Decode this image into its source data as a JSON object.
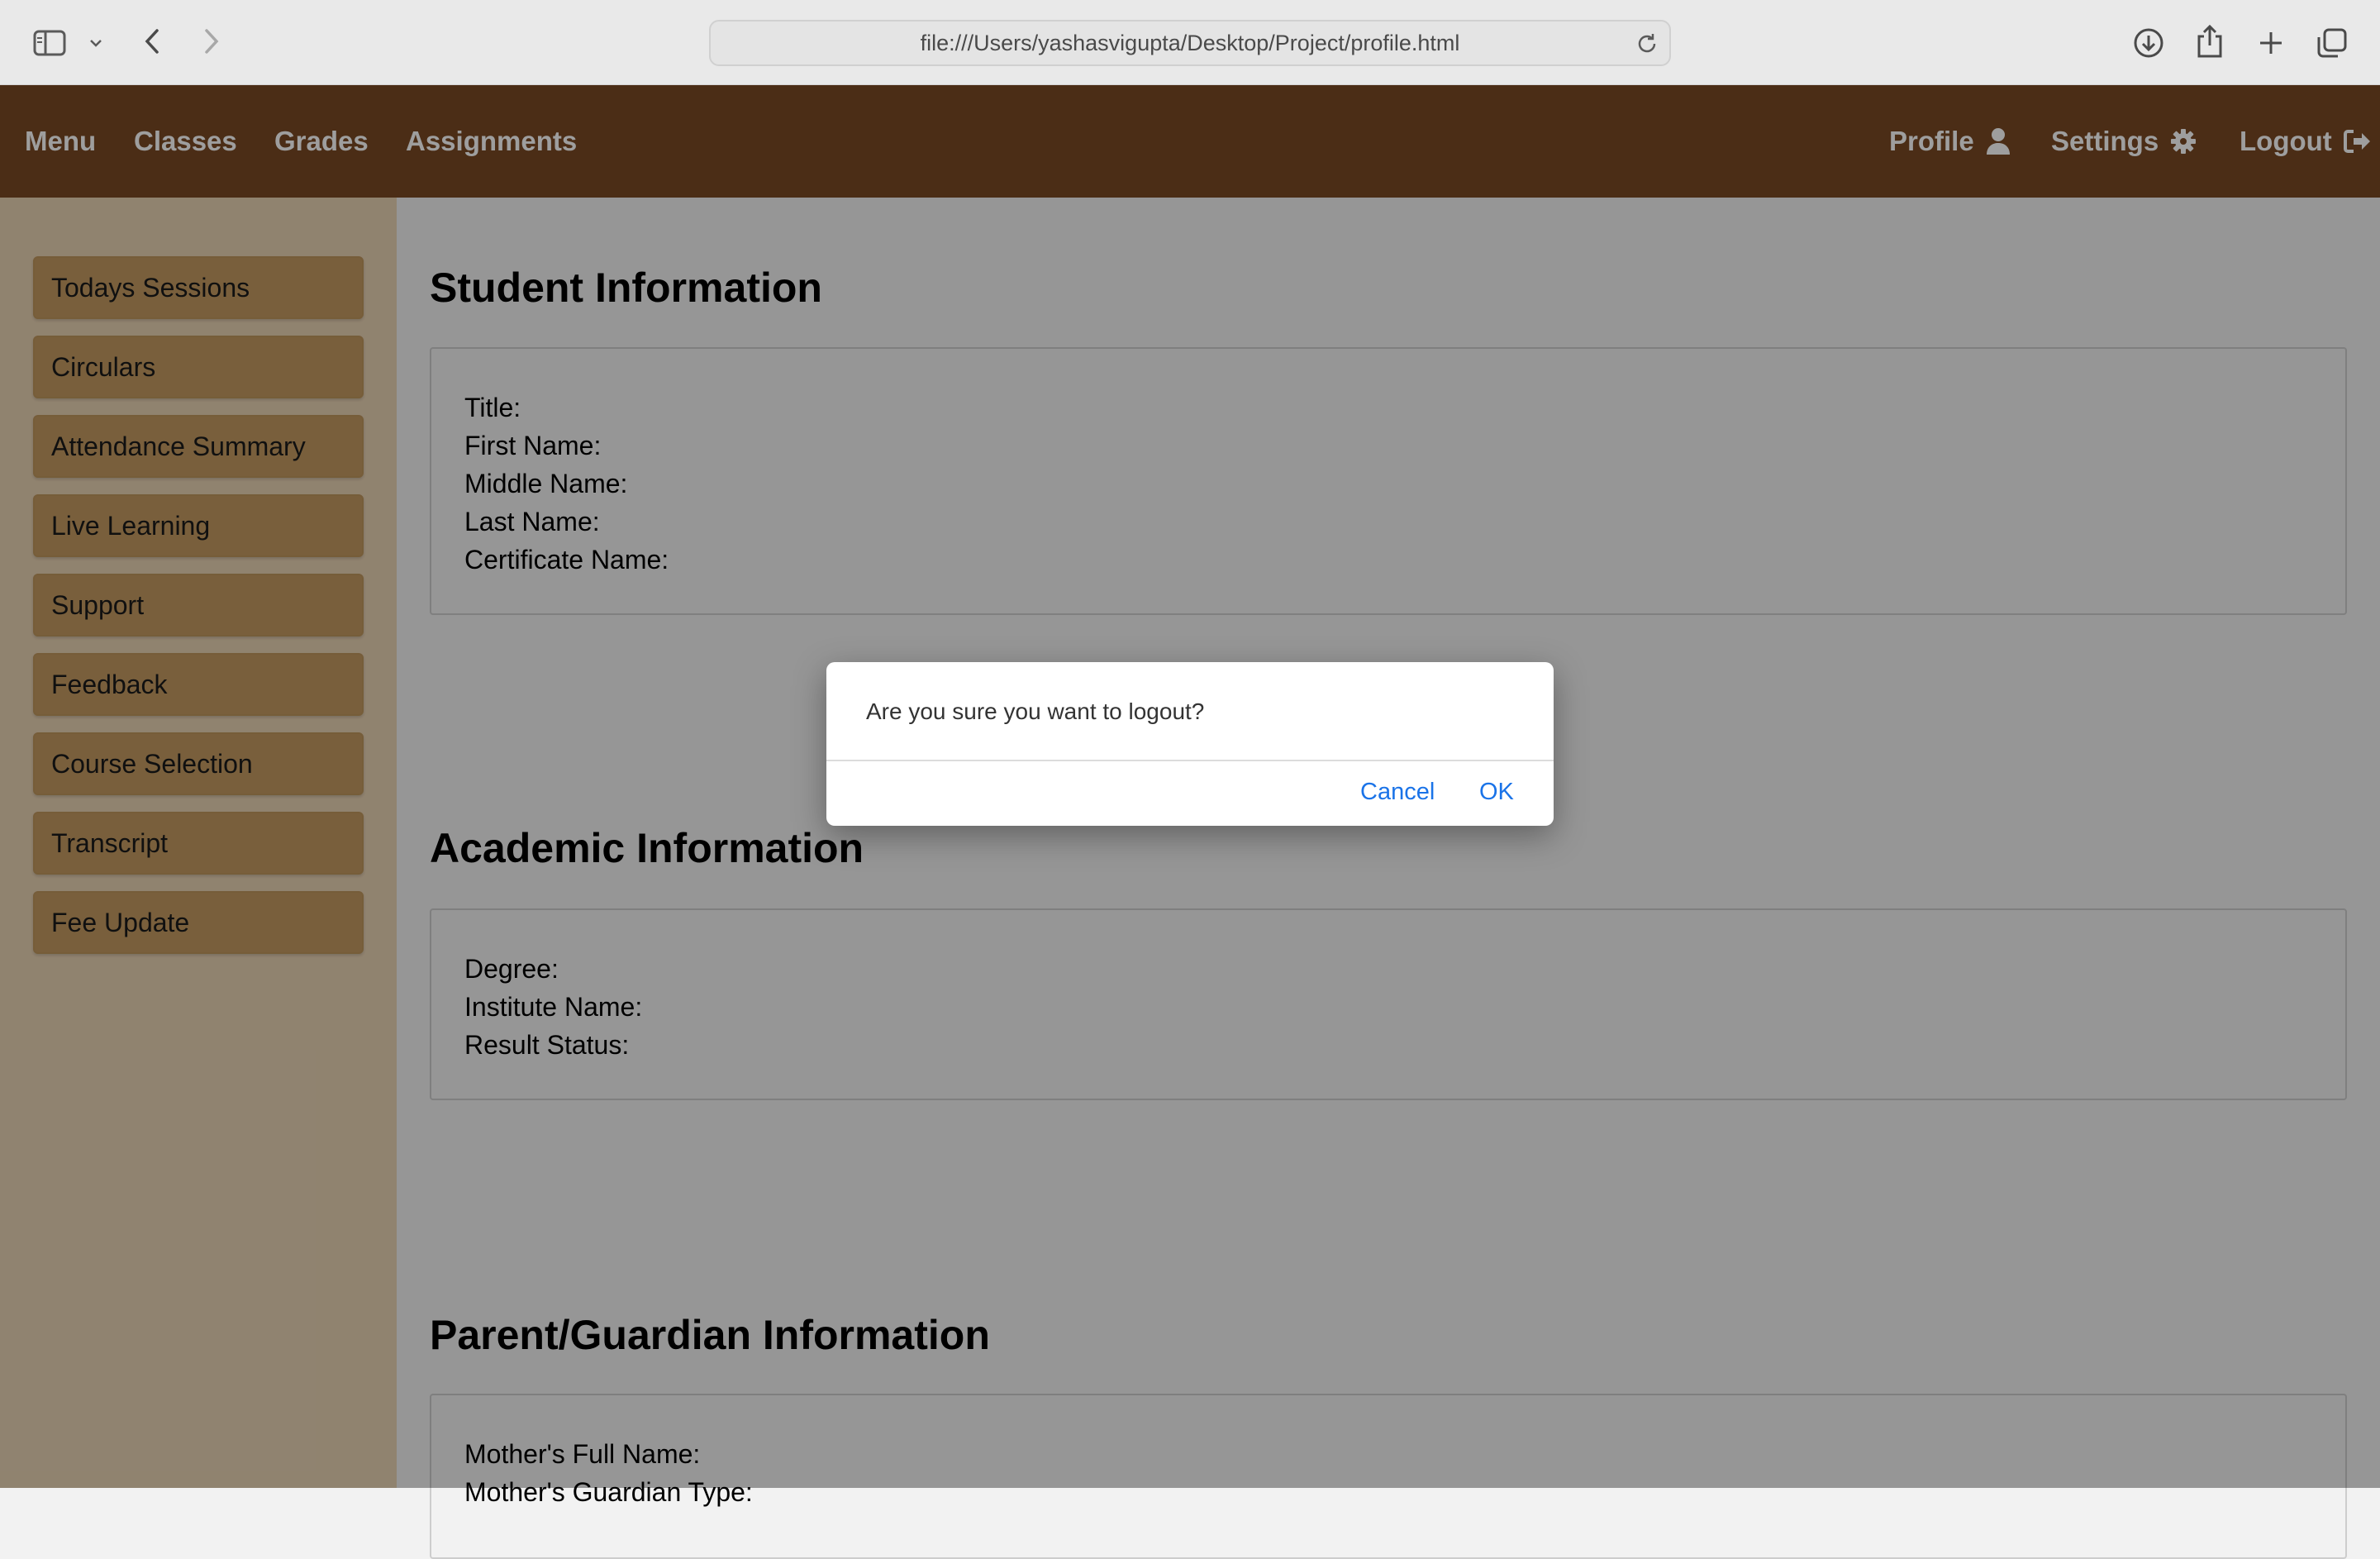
{
  "browser": {
    "url": "file:///Users/yashasvigupta/Desktop/Project/profile.html",
    "icons": [
      "sidebar-icon",
      "chevron-down-icon",
      "back-icon",
      "forward-icon",
      "reload-icon",
      "download-icon",
      "share-icon",
      "new-tab-icon",
      "tab-overview-icon"
    ]
  },
  "nav": {
    "menu": "Menu",
    "classes": "Classes",
    "grades": "Grades",
    "assignments": "Assignments",
    "profile": "Profile",
    "settings": "Settings",
    "logout": "Logout"
  },
  "sidebar": {
    "items": [
      {
        "label": "Todays Sessions"
      },
      {
        "label": "Circulars"
      },
      {
        "label": "Attendance Summary"
      },
      {
        "label": "Live Learning"
      },
      {
        "label": "Support"
      },
      {
        "label": "Feedback"
      },
      {
        "label": "Course Selection"
      },
      {
        "label": "Transcript"
      },
      {
        "label": "Fee Update"
      }
    ]
  },
  "main": {
    "student": {
      "title": "Student Information",
      "fields": [
        "Title:",
        "First Name:",
        "Middle Name:",
        "Last Name:",
        "Certificate Name:"
      ]
    },
    "academic": {
      "title": "Academic Information",
      "fields": [
        "Degree:",
        "Institute Name:",
        "Result Status:"
      ]
    },
    "parent": {
      "title": "Parent/Guardian Information",
      "fields": [
        "Mother's Full Name:",
        "Mother's Guardian Type:"
      ]
    }
  },
  "dialog": {
    "message": "Are you sure you want to logout?",
    "cancel": "Cancel",
    "ok": "OK"
  },
  "colors": {
    "nav_bg": "#7a4a24",
    "sidebar_bg": "#e9d3b4",
    "sidebar_button": "#c49a62",
    "dialog_link": "#1a73e8"
  }
}
